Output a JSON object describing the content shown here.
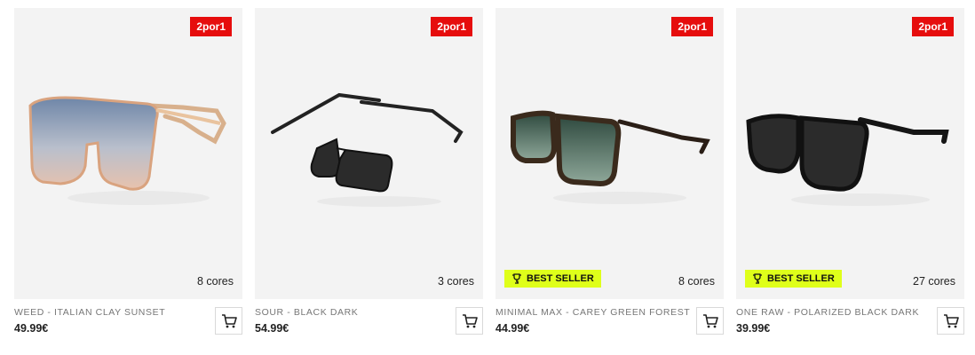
{
  "products": [
    {
      "promo": "2por1",
      "colors": "8 cores",
      "name": "WEED - ITALIAN CLAY SUNSET",
      "price": "49.99€",
      "best_seller": ""
    },
    {
      "promo": "2por1",
      "colors": "3 cores",
      "name": "SOUR - BLACK DARK",
      "price": "54.99€",
      "best_seller": ""
    },
    {
      "promo": "2por1",
      "colors": "8 cores",
      "name": "MINIMAL MAX - CAREY GREEN FOREST",
      "price": "44.99€",
      "best_seller": "BEST SELLER"
    },
    {
      "promo": "2por1",
      "colors": "27 cores",
      "name": "ONE RAW - POLARIZED BLACK DARK",
      "price": "39.99€",
      "best_seller": "BEST SELLER"
    }
  ],
  "colors": {
    "promo_red": "#e60d0d",
    "best_seller_bg": "#dfff1a",
    "image_bg": "#f3f3f3"
  },
  "icons": {
    "cart": "cart-icon",
    "trophy": "trophy-icon"
  }
}
